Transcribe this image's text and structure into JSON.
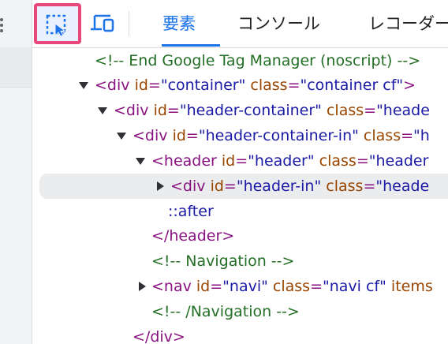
{
  "toolbar": {
    "tabs": [
      {
        "label": "要素",
        "active": true
      },
      {
        "label": "コンソール",
        "active": false
      },
      {
        "label": "レコーダー",
        "active": false
      }
    ]
  },
  "tree": {
    "line1": "<!-- End Google Tag Manager (noscript) -->",
    "line2": {
      "tag_open": "<div",
      "a1": "id",
      "v1": "\"container\"",
      "a2": "class",
      "v2": "\"container cf\"",
      "close": ">"
    },
    "line3": {
      "tag_open": "<div",
      "a1": "id",
      "v1": "\"header-container\"",
      "a2": "class",
      "v2": "\"heade"
    },
    "line4": {
      "tag_open": "<div",
      "a1": "id",
      "v1": "\"header-container-in\"",
      "a2": "class",
      "v2": "\"h"
    },
    "line5": {
      "tag_open": "<header",
      "a1": "id",
      "v1": "\"header\"",
      "a2": "class",
      "v2": "\"header"
    },
    "line6": {
      "tag_open": "<div",
      "a1": "id",
      "v1": "\"header-in\"",
      "a2": "class",
      "v2": "\"heade"
    },
    "line7": "::after",
    "line8": "</header>",
    "line9": "<!-- Navigation -->",
    "line10": {
      "tag_open": "<nav",
      "a1": "id",
      "v1": "\"navi\"",
      "a2": "class",
      "v2": "\"navi cf\"",
      "a3": "items"
    },
    "line11": "<!-- /Navigation -->",
    "line12": "</div>"
  },
  "colors": {
    "accent": "#1a73e8",
    "highlight_border": "#e8477a",
    "tag": "#881280",
    "attr": "#994500",
    "value": "#1a1aa6",
    "comment": "#236e25"
  }
}
